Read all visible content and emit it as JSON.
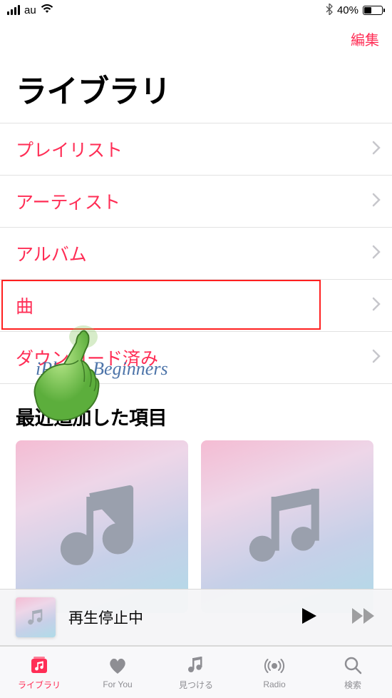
{
  "status": {
    "carrier": "au",
    "battery_percent": "40%"
  },
  "nav": {
    "edit": "編集"
  },
  "title": "ライブラリ",
  "rows": [
    {
      "label": "プレイリスト"
    },
    {
      "label": "アーティスト"
    },
    {
      "label": "アルバム"
    },
    {
      "label": "曲"
    },
    {
      "label": "ダウンロード済み"
    }
  ],
  "section": {
    "recently_added": "最近追加した項目"
  },
  "watermark": "iPhone Beginners",
  "now_playing": {
    "status": "再生停止中"
  },
  "tabs": {
    "library": "ライブラリ",
    "for_you": "For You",
    "browse": "見つける",
    "radio": "Radio",
    "search": "検索"
  }
}
